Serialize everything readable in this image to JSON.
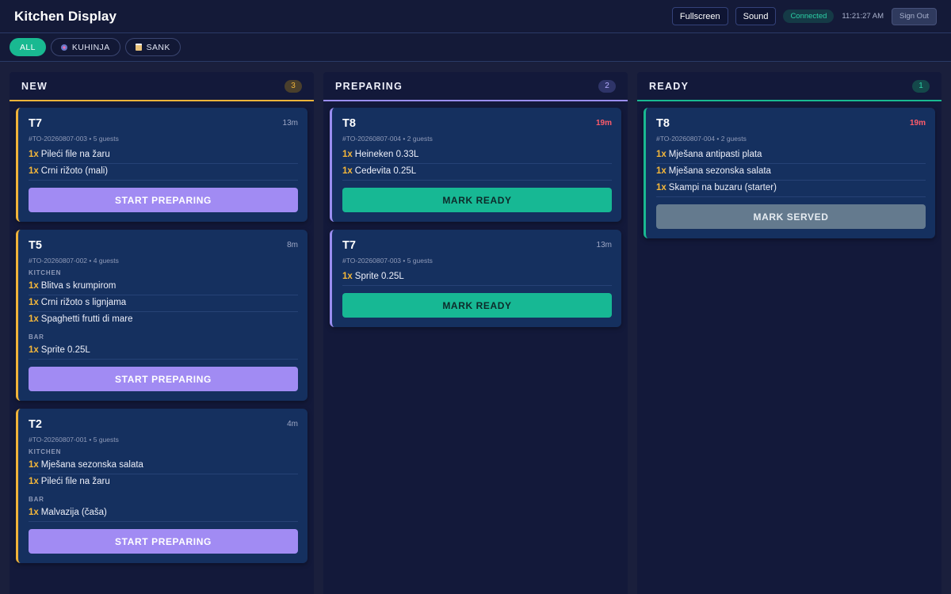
{
  "app": {
    "title": "Kitchen Display",
    "controls": {
      "fullscreen": "Fullscreen",
      "sound": "Sound",
      "status": "Connected",
      "clock": "11:21:27 AM",
      "signout": "Sign Out"
    }
  },
  "filters": [
    {
      "label": "ALL",
      "icon": "",
      "active": true
    },
    {
      "label": "KUHINJA",
      "icon": "kitchen-icon",
      "active": false
    },
    {
      "label": "SANK",
      "icon": "beer-mug-icon",
      "active": false
    }
  ],
  "columns": {
    "new": {
      "title": "NEW",
      "count": "3",
      "tickets": [
        {
          "table": "T7",
          "age": "13m",
          "meta": "#TO-20260807-003 • 5 guests",
          "sections": [
            {
              "label": "",
              "items": [
                {
                  "qty": "1x",
                  "name": "Pileći file na žaru"
                },
                {
                  "qty": "1x",
                  "name": "Crni rižoto (mali)"
                }
              ]
            }
          ],
          "action": "START PREPARING"
        },
        {
          "table": "T5",
          "age": "8m",
          "meta": "#TO-20260807-002 • 4 guests",
          "sections": [
            {
              "label": "KITCHEN",
              "items": [
                {
                  "qty": "1x",
                  "name": "Blitva s krumpirom"
                },
                {
                  "qty": "1x",
                  "name": "Crni rižoto s lignjama"
                },
                {
                  "qty": "1x",
                  "name": "Spaghetti frutti di mare"
                }
              ]
            },
            {
              "label": "BAR",
              "items": [
                {
                  "qty": "1x",
                  "name": "Sprite 0.25L"
                }
              ]
            }
          ],
          "action": "START PREPARING"
        },
        {
          "table": "T2",
          "age": "4m",
          "meta": "#TO-20260807-001 • 5 guests",
          "sections": [
            {
              "label": "KITCHEN",
              "items": [
                {
                  "qty": "1x",
                  "name": "Mješana sezonska salata"
                },
                {
                  "qty": "1x",
                  "name": "Pileći file na žaru"
                }
              ]
            },
            {
              "label": "BAR",
              "items": [
                {
                  "qty": "1x",
                  "name": "Malvazija (čaša)"
                }
              ]
            }
          ],
          "action": "START PREPARING"
        }
      ]
    },
    "preparing": {
      "title": "PREPARING",
      "count": "2",
      "tickets": [
        {
          "table": "T8",
          "age": "19m",
          "late": true,
          "meta": "#TO-20260807-004 • 2 guests",
          "sections": [
            {
              "label": "",
              "items": [
                {
                  "qty": "1x",
                  "name": "Heineken 0.33L"
                },
                {
                  "qty": "1x",
                  "name": "Cedevita 0.25L"
                }
              ]
            }
          ],
          "action": "MARK READY"
        },
        {
          "table": "T7",
          "age": "13m",
          "meta": "#TO-20260807-003 • 5 guests",
          "sections": [
            {
              "label": "",
              "items": [
                {
                  "qty": "1x",
                  "name": "Sprite 0.25L"
                }
              ]
            }
          ],
          "action": "MARK READY"
        }
      ]
    },
    "ready": {
      "title": "READY",
      "count": "1",
      "tickets": [
        {
          "table": "T8",
          "age": "19m",
          "late": true,
          "meta": "#TO-20260807-004 • 2 guests",
          "sections": [
            {
              "label": "",
              "items": [
                {
                  "qty": "1x",
                  "name": "Mješana antipasti plata"
                },
                {
                  "qty": "1x",
                  "name": "Mješana sezonska salata"
                },
                {
                  "qty": "1x",
                  "name": "Skampi na buzaru (starter)"
                }
              ]
            }
          ],
          "action": "MARK SERVED"
        }
      ]
    }
  }
}
